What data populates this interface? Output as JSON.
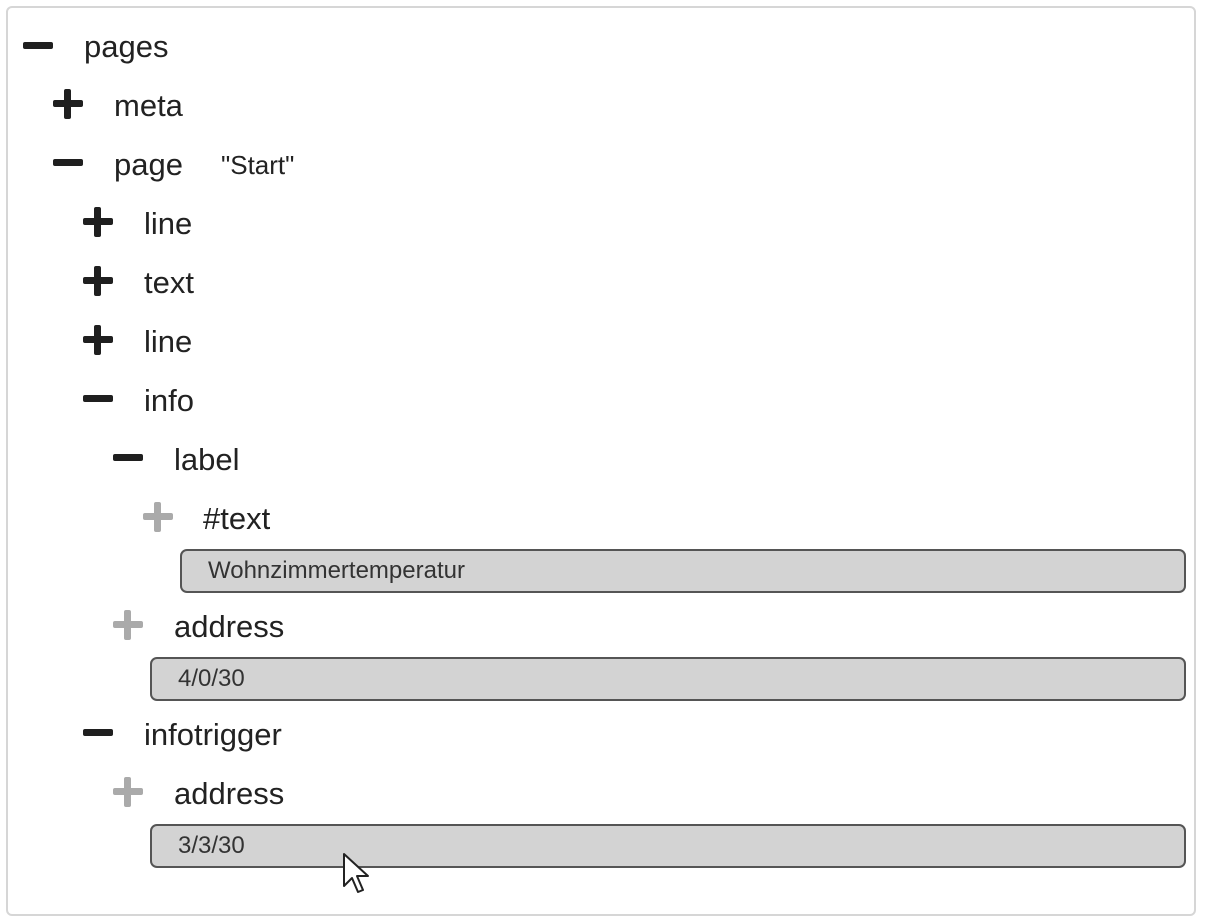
{
  "tree": {
    "pages": {
      "label": "pages",
      "state": "expanded"
    },
    "meta": {
      "label": "meta",
      "state": "collapsed"
    },
    "page": {
      "label": "page",
      "attr": "\"Start\"",
      "state": "expanded"
    },
    "line1": {
      "label": "line",
      "state": "collapsed"
    },
    "text": {
      "label": "text",
      "state": "collapsed"
    },
    "line2": {
      "label": "line",
      "state": "collapsed"
    },
    "info": {
      "label": "info",
      "state": "expanded"
    },
    "label_node": {
      "label": "label",
      "state": "expanded"
    },
    "text_node": {
      "label": "#text",
      "state": "collapsed-disabled",
      "value": "Wohnzimmertemperatur"
    },
    "info_address": {
      "label": "address",
      "state": "collapsed-disabled",
      "value": "4/0/30"
    },
    "infotrigger": {
      "label": "infotrigger",
      "state": "expanded"
    },
    "infotrigger_address": {
      "label": "address",
      "state": "collapsed-disabled",
      "value": "3/3/30"
    }
  },
  "icons": {
    "expanded": "minus-icon",
    "collapsed": "plus-icon",
    "collapsed-disabled": "plus-icon"
  },
  "colors": {
    "icon_dark": "#1f1f1f",
    "icon_disabled": "#aaaaaa",
    "field_bg": "#d3d3d3",
    "field_border": "#555555",
    "panel_border": "#d6d6d6"
  }
}
